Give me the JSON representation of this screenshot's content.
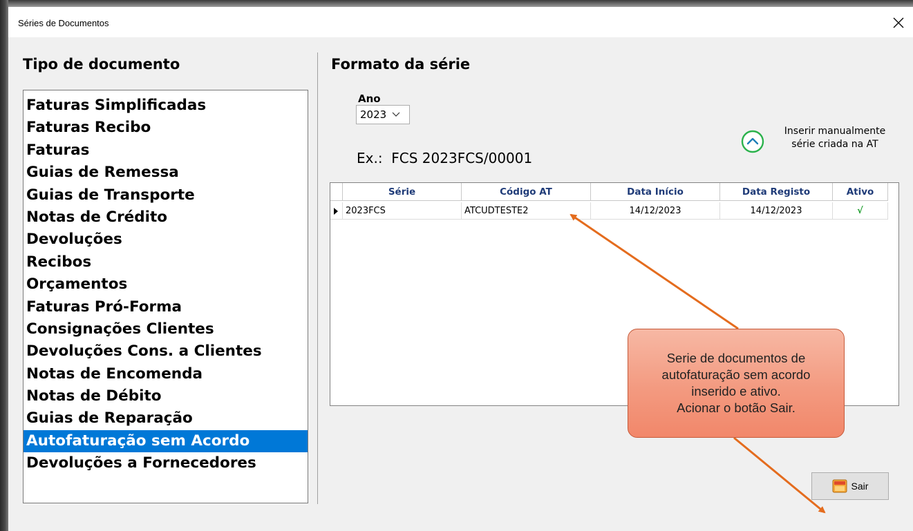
{
  "window": {
    "title": "Séries de Documentos",
    "close_glyph": "✕"
  },
  "left_panel": {
    "heading": "Tipo de documento",
    "items": [
      {
        "label": "Faturas Simplificadas"
      },
      {
        "label": "Faturas Recibo"
      },
      {
        "label": "Faturas"
      },
      {
        "label": "Guias de Remessa"
      },
      {
        "label": "Guias de Transporte"
      },
      {
        "label": "Notas de Crédito"
      },
      {
        "label": "Devoluções"
      },
      {
        "label": "Recibos"
      },
      {
        "label": "Orçamentos"
      },
      {
        "label": "Faturas Pró-Forma"
      },
      {
        "label": "Consignações Clientes"
      },
      {
        "label": "Devoluções Cons. a Clientes"
      },
      {
        "label": "Notas de Encomenda"
      },
      {
        "label": "Notas de Débito"
      },
      {
        "label": "Guias de Reparação"
      },
      {
        "label": "Autofaturação sem Acordo"
      },
      {
        "label": "Devoluções a Fornecedores"
      }
    ],
    "selected_label": "Autofaturação sem Acordo",
    "selection_color": "#0078d7"
  },
  "right_panel": {
    "heading": "Formato da série",
    "year": {
      "label": "Ano",
      "value": "2023"
    },
    "example_text": "Ex.:  FCS 2023FCS/00001",
    "insert_manual": {
      "line1": "Inserir manualmente",
      "line2": "série criada na AT",
      "icon": "chevron-up-circle-icon",
      "icon_color": "#2bb24c"
    },
    "grid": {
      "columns": [
        "Série",
        "Código AT",
        "Data Início",
        "Data Registo",
        "Ativo"
      ],
      "rows": [
        {
          "serie": "2023FCS",
          "codigo_at": "ATCUDTESTE2",
          "data_inicio": "14/12/2023",
          "data_registo": "14/12/2023",
          "ativo": "√"
        }
      ],
      "header_color": "#1f3b78",
      "check_color": "#1a9d2a"
    },
    "sair_button": {
      "label": "Sair",
      "icon": "exit-door-icon"
    }
  },
  "annotation": {
    "callout_lines": [
      "Serie de documentos de",
      "autofaturação sem acordo",
      "inserido e ativo.",
      "Acionar o botão Sair."
    ],
    "arrow_color": "#e46c1e",
    "callout_fill": "#f39a80"
  }
}
